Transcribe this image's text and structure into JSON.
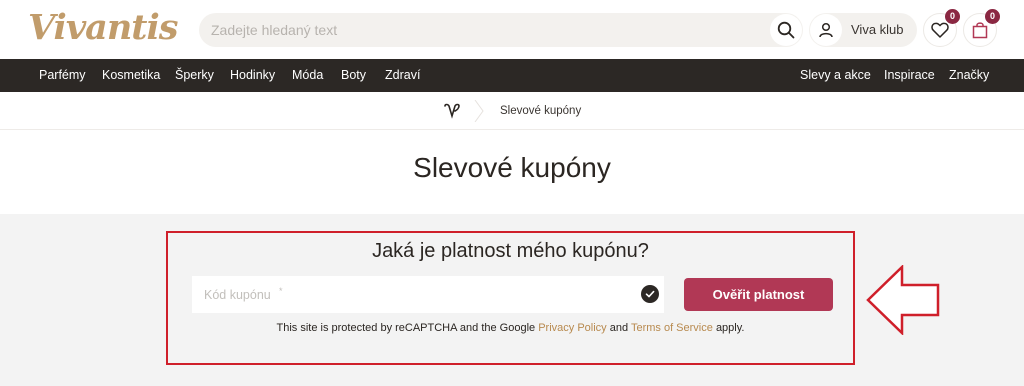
{
  "header": {
    "logo_text": "Vivantis",
    "search_placeholder": "Zadejte hledaný text",
    "club_label": "Viva klub",
    "wishlist_count": "0",
    "cart_count": "0"
  },
  "nav": {
    "left": [
      "Parfémy",
      "Kosmetika",
      "Šperky",
      "Hodinky",
      "Móda",
      "Boty",
      "Zdraví"
    ],
    "right": [
      "Slevy a akce",
      "Inspirace",
      "Značky"
    ]
  },
  "breadcrumb": {
    "current": "Slevové kupóny"
  },
  "page_title": "Slevové kupóny",
  "coupon_form": {
    "question": "Jaká je platnost mého kupónu?",
    "input_placeholder": "Kód kupónu",
    "required_mark": "*",
    "button_label": "Ověřit platnost",
    "recaptcha_prefix": "This site is protected by reCAPTCHA and the Google",
    "privacy_link": "Privacy Policy",
    "and_text": "and",
    "terms_link": "Terms of Service",
    "apply_text": "apply."
  },
  "colors": {
    "brand_gold": "#c19c6b",
    "nav_bg": "#2c2825",
    "button_bg": "#b13855",
    "badge_bg": "#8a2742",
    "highlight_red": "#cf1f2a"
  }
}
